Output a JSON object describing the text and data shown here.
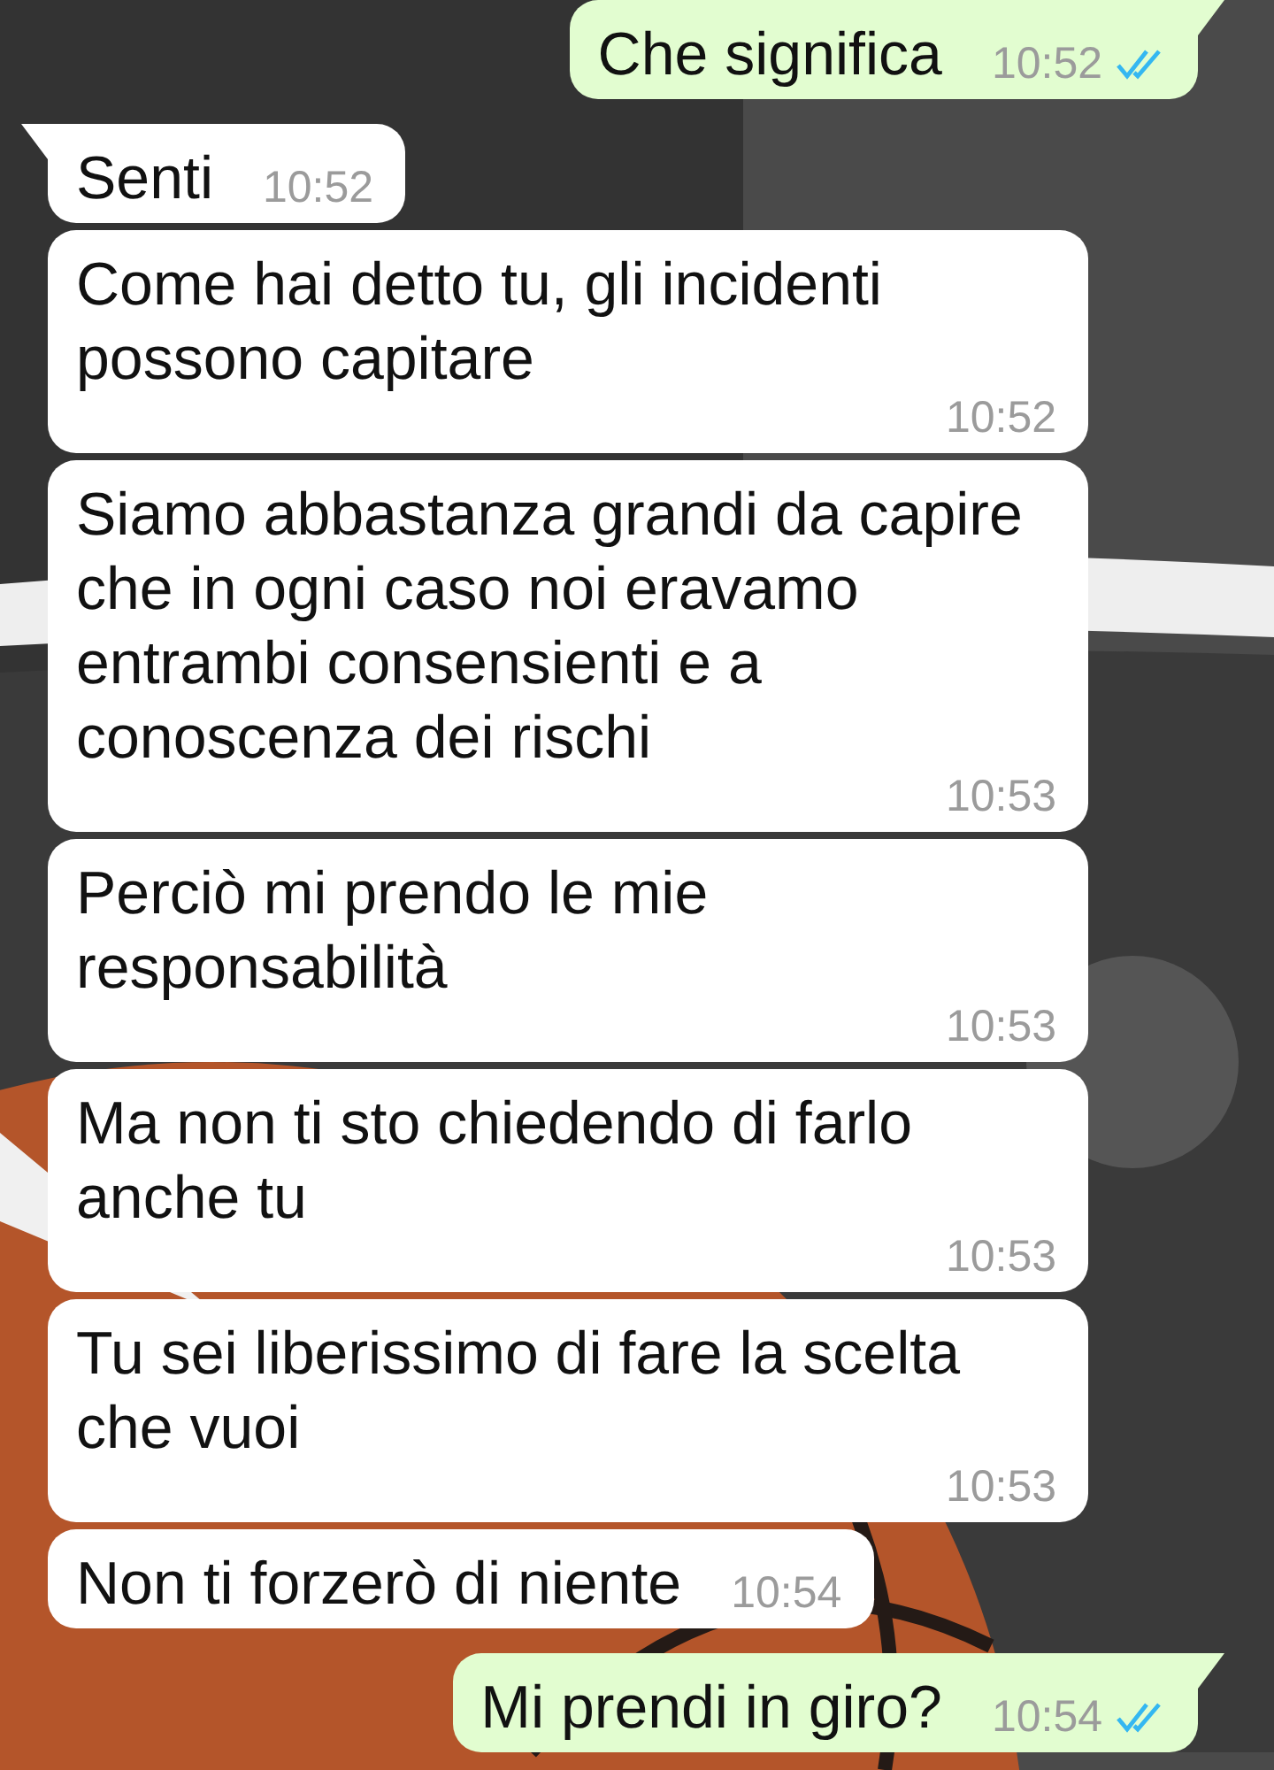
{
  "messages": [
    {
      "kind": "sent",
      "text": "Che significa",
      "time": "10:52",
      "read": true,
      "tail": true
    },
    {
      "kind": "received",
      "text": "Senti",
      "time": "10:52",
      "tail": true
    },
    {
      "kind": "received",
      "text": "Come hai detto tu, gli incidenti possono capitare",
      "time": "10:52",
      "tail": false
    },
    {
      "kind": "received",
      "text": "Siamo abbastanza grandi da capire che in ogni caso noi eravamo entrambi consensienti e a conoscenza dei rischi",
      "time": "10:53",
      "tail": false
    },
    {
      "kind": "received",
      "text": "Perciò mi prendo le mie responsabilità",
      "time": "10:53",
      "tail": false
    },
    {
      "kind": "received",
      "text": "Ma non ti sto chiedendo di farlo anche tu",
      "time": "10:53",
      "tail": false
    },
    {
      "kind": "received",
      "text": "Tu sei liberissimo di fare la scelta che vuoi",
      "time": "10:53",
      "tail": false
    },
    {
      "kind": "received",
      "text": "Non ti forzerò di niente",
      "time": "10:54",
      "tail": false
    },
    {
      "kind": "sent",
      "text": "Mi prendi in giro?",
      "time": "10:54",
      "read": true,
      "tail": true
    }
  ]
}
